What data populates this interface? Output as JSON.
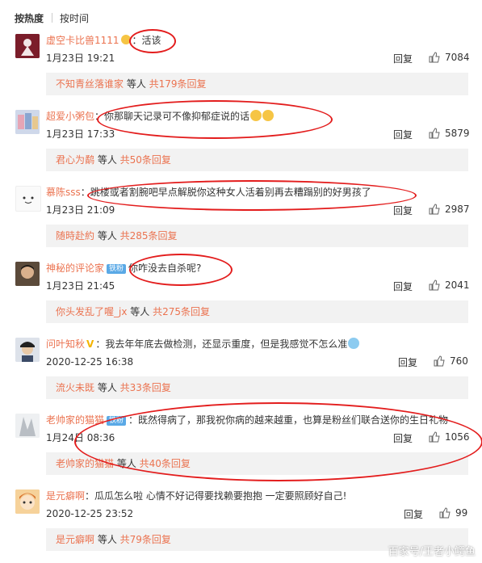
{
  "tabs": {
    "hot": "按热度",
    "time": "按时间"
  },
  "reply_label": "回复",
  "comments": [
    {
      "user": "虚空卡比兽1111",
      "text": "：活该",
      "date": "1月23日 19:21",
      "likes": "7084",
      "sub_user": "不知青丝落谁家",
      "sub_etc": " 等人 ",
      "sub_count": "共179条回复"
    },
    {
      "user": "超爱小粥包",
      "text": "：你那聊天记录可不像抑郁症说的话",
      "date": "1月23日 17:33",
      "likes": "5879",
      "sub_user": "君心为鹬",
      "sub_etc": " 等人 ",
      "sub_count": "共50条回复"
    },
    {
      "user": "慕陈sss",
      "text": "：跳楼或者割腕吧早点解脱你这种女人活着别再去糟蹋别的好男孩了",
      "date": "1月23日 21:09",
      "likes": "2987",
      "sub_user": "随時赴約",
      "sub_etc": " 等人 ",
      "sub_count": "共285条回复"
    },
    {
      "user": "神秘的评论家",
      "badge": "铁粉",
      "text": "你咋没去自杀呢?",
      "date": "1月23日 21:45",
      "likes": "2041",
      "sub_user": "你头发乱了喔_jx",
      "sub_etc": " 等人 ",
      "sub_count": "共275条回复"
    },
    {
      "user": "问叶知秋",
      "vmark": "V",
      "text": "：我去年年底去做检测，还显示重度，但是我感觉不怎么准",
      "date": "2020-12-25 16:38",
      "likes": "760",
      "sub_user": "流火未既",
      "sub_etc": " 等人 ",
      "sub_count": "共33条回复"
    },
    {
      "user": "老帅家的猫猫",
      "badge": "铁粉",
      "text": "：既然得病了，那我祝你病的越来越重，也算是粉丝们联合送你的生日礼物",
      "date": "1月24日 08:36",
      "likes": "1056",
      "sub_user": "老帅家的猫猫",
      "sub_etc": " 等人 ",
      "sub_count": "共40条回复"
    },
    {
      "user": "是元癖啊",
      "text": "：瓜瓜怎么啦 心情不好记得要找赖要抱抱 一定要照顾好自己!",
      "date": "2020-12-25 23:52",
      "likes": "99",
      "sub_user": "是元癖啊",
      "sub_etc": " 等人 ",
      "sub_count": "共79条回复"
    }
  ],
  "watermark": "百家号/王者小鳄鱼",
  "colors": {
    "username": "#eb7350",
    "annotation": "#e31d1d",
    "subbox_bg": "#f2f2f2"
  }
}
